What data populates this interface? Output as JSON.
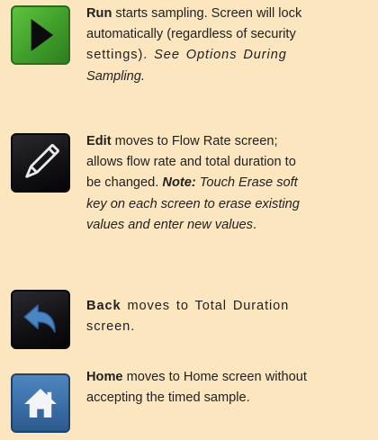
{
  "entries": [
    {
      "icon": "play-icon",
      "lead": "Run",
      "line1_rest": " starts sampling. Screen will lock",
      "line2": "automatically (regardless of security",
      "line3_a": "settings). ",
      "line3_b": "See Options During",
      "line4": "Sampling."
    },
    {
      "icon": "pencil-icon",
      "lead": "Edit",
      "line1_rest": " moves to Flow Rate screen;",
      "line2": "allows flow rate and total duration to",
      "line3_a": "be changed. ",
      "line3_b": "Note:",
      "line3_c": " Touch Erase soft",
      "line4": "key on each screen to erase existing",
      "line5_a": "values and enter new values",
      "line5_b": "."
    },
    {
      "icon": "back-arrow-icon",
      "lead": "Back",
      "line1_rest": " moves to Total Duration",
      "line2": "screen."
    },
    {
      "icon": "home-icon",
      "lead": "Home",
      "line1_rest": " moves to Home screen without",
      "line2": "accepting the timed sample."
    }
  ],
  "colors": {
    "background": "#fbe6bf",
    "run_green": "#4caf32",
    "dark_button": "#111114",
    "home_blue": "#3a6ea7"
  }
}
